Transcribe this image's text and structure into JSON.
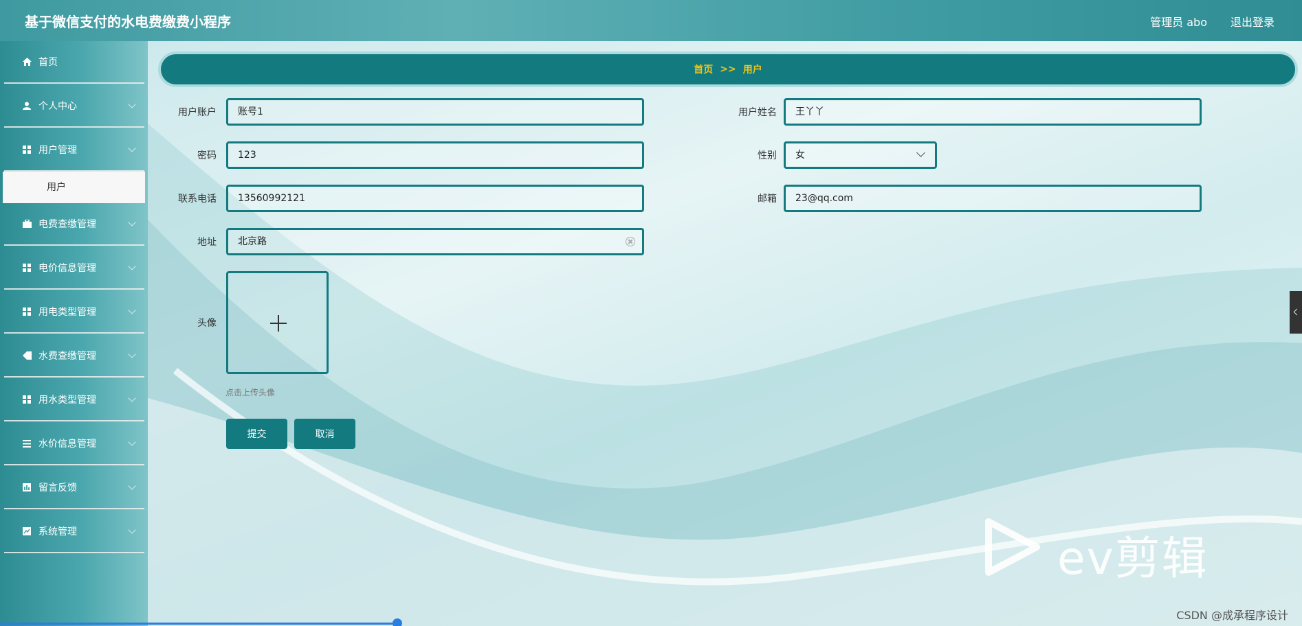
{
  "app": {
    "title": "基于微信支付的水电费缴费小程序"
  },
  "header": {
    "user": "管理员 abo",
    "logout": "退出登录"
  },
  "sidebar": {
    "items": [
      {
        "label": "首页",
        "icon": "home-icon"
      },
      {
        "label": "个人中心",
        "icon": "person-icon"
      },
      {
        "label": "用户管理",
        "icon": "grid-icon"
      },
      {
        "label": "电费查缴管理",
        "icon": "briefcase-icon"
      },
      {
        "label": "电价信息管理",
        "icon": "grid-icon"
      },
      {
        "label": "用电类型管理",
        "icon": "grid-icon"
      },
      {
        "label": "水费查缴管理",
        "icon": "tag-icon"
      },
      {
        "label": "用水类型管理",
        "icon": "grid-icon"
      },
      {
        "label": "水价信息管理",
        "icon": "list-icon"
      },
      {
        "label": "留言反馈",
        "icon": "chart-icon"
      },
      {
        "label": "系统管理",
        "icon": "trend-icon"
      }
    ],
    "sub_item": "用户"
  },
  "breadcrumb": {
    "home": "首页",
    "sep": ">>",
    "current": "用户"
  },
  "form": {
    "account_label": "用户账户",
    "account_value": "账号1",
    "name_label": "用户姓名",
    "name_value": "王丫丫",
    "password_label": "密码",
    "password_value": "123",
    "gender_label": "性别",
    "gender_value": "女",
    "phone_label": "联系电话",
    "phone_value": "13560992121",
    "email_label": "邮箱",
    "email_value": "23@qq.com",
    "address_label": "地址",
    "address_value": "北京路",
    "avatar_label": "头像",
    "avatar_hint": "点击上传头像",
    "submit": "提交",
    "cancel": "取消"
  },
  "watermark": {
    "brand": "ev剪辑",
    "credit": "CSDN @成承程序设计"
  },
  "colors": {
    "primary": "#137a80",
    "breadcrumb_text": "#f0c419",
    "topbar": "#4aa7ad"
  }
}
